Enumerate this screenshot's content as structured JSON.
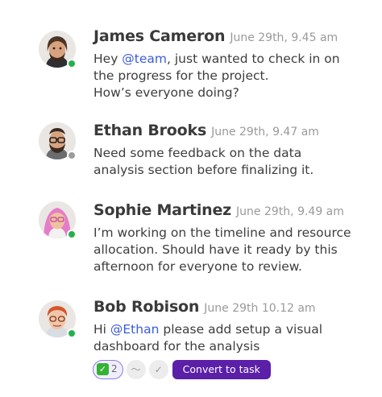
{
  "colors": {
    "online": "#22b14c",
    "offline": "#9b9b9b",
    "mention": "#3b5bdb",
    "accent": "#5b1fa8"
  },
  "messages": [
    {
      "author": "James Cameron",
      "time": "June 29th, 9.45 am",
      "status": "online",
      "lines": [
        {
          "pre": "Hey ",
          "mention": "@team",
          "post": ", just wanted to check in on"
        },
        {
          "pre": "the progress for the project."
        },
        {
          "pre": "How’s everyone doing?"
        }
      ]
    },
    {
      "author": "Ethan Brooks",
      "time": "June 29th, 9.47 am",
      "status": "offline",
      "lines": [
        {
          "pre": "Need some feedback on the data"
        },
        {
          "pre": "analysis section before finalizing it."
        }
      ]
    },
    {
      "author": "Sophie Martinez",
      "time": "June 29th, 9.49 am",
      "status": "online",
      "lines": [
        {
          "pre": "I’m working on the timeline and resource"
        },
        {
          "pre": "allocation. Should have it ready by this"
        },
        {
          "pre": "afternoon for everyone to review."
        }
      ]
    },
    {
      "author": "Bob Robison",
      "time": "June 29th 10.12 am",
      "status": "online",
      "lines": [
        {
          "pre": "Hi ",
          "mention": "@Ethan",
          "post": " please add setup a visual"
        },
        {
          "pre": "dashboard for the analysis"
        }
      ]
    }
  ],
  "reactions": {
    "check": {
      "icon": "check-mark-icon",
      "count": "2"
    },
    "icons": [
      "ok-hand-icon",
      "check-icon"
    ],
    "convert_label": "Convert to task"
  }
}
